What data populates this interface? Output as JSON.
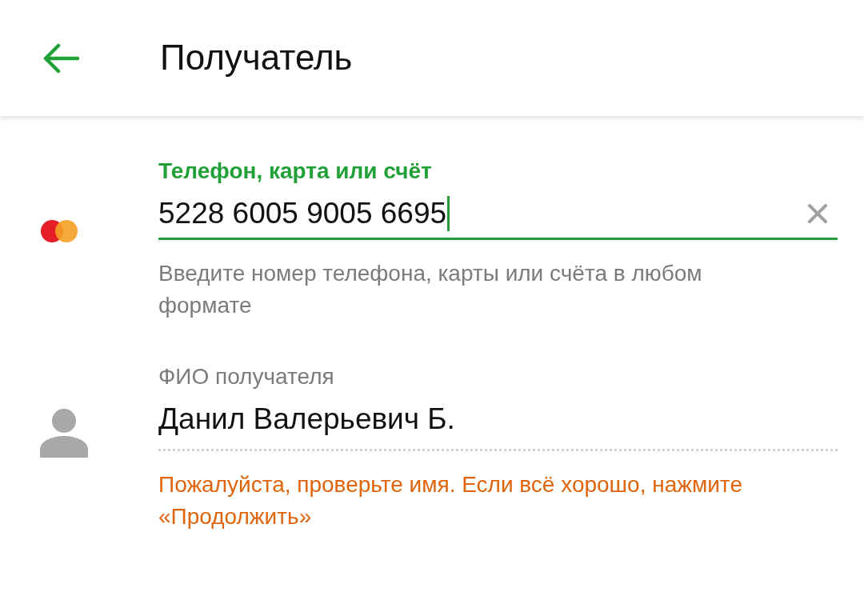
{
  "header": {
    "title": "Получатель"
  },
  "fields": [
    {
      "kind": "account",
      "label": "Телефон, карта или счёт",
      "value": "5228 6005 9005 6695",
      "focused": true,
      "helper": {
        "kind": "hint",
        "text": "Введите номер телефона, карты или счёта в любом формате"
      }
    },
    {
      "kind": "name",
      "label": "ФИО получателя",
      "value": "Данил Валерьевич Б.",
      "focused": false,
      "helper": {
        "kind": "warning",
        "text": "Пожалуйста, проверьте имя. Если всё хорошо, нажмите «Продолжить»"
      }
    }
  ]
}
